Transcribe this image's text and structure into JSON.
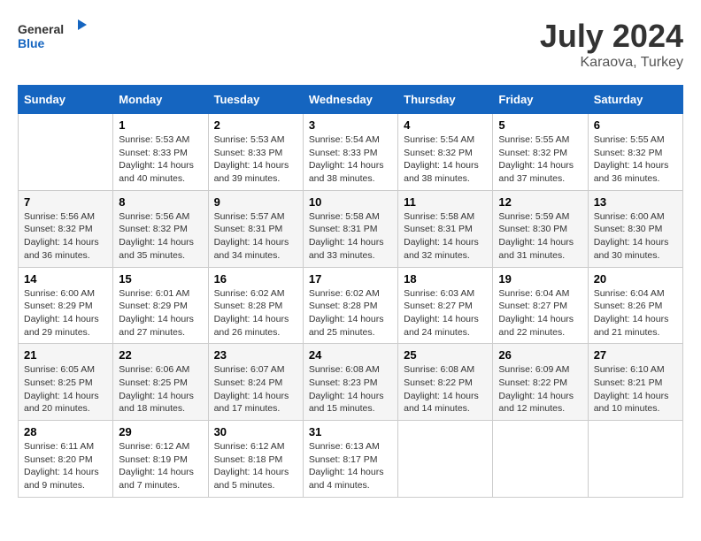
{
  "header": {
    "logo_line1": "General",
    "logo_line2": "Blue",
    "month_year": "July 2024",
    "location": "Karaova, Turkey"
  },
  "days_of_week": [
    "Sunday",
    "Monday",
    "Tuesday",
    "Wednesday",
    "Thursday",
    "Friday",
    "Saturday"
  ],
  "weeks": [
    [
      {
        "day": "",
        "info": ""
      },
      {
        "day": "1",
        "info": "Sunrise: 5:53 AM\nSunset: 8:33 PM\nDaylight: 14 hours\nand 40 minutes."
      },
      {
        "day": "2",
        "info": "Sunrise: 5:53 AM\nSunset: 8:33 PM\nDaylight: 14 hours\nand 39 minutes."
      },
      {
        "day": "3",
        "info": "Sunrise: 5:54 AM\nSunset: 8:33 PM\nDaylight: 14 hours\nand 38 minutes."
      },
      {
        "day": "4",
        "info": "Sunrise: 5:54 AM\nSunset: 8:32 PM\nDaylight: 14 hours\nand 38 minutes."
      },
      {
        "day": "5",
        "info": "Sunrise: 5:55 AM\nSunset: 8:32 PM\nDaylight: 14 hours\nand 37 minutes."
      },
      {
        "day": "6",
        "info": "Sunrise: 5:55 AM\nSunset: 8:32 PM\nDaylight: 14 hours\nand 36 minutes."
      }
    ],
    [
      {
        "day": "7",
        "info": "Sunrise: 5:56 AM\nSunset: 8:32 PM\nDaylight: 14 hours\nand 36 minutes."
      },
      {
        "day": "8",
        "info": "Sunrise: 5:56 AM\nSunset: 8:32 PM\nDaylight: 14 hours\nand 35 minutes."
      },
      {
        "day": "9",
        "info": "Sunrise: 5:57 AM\nSunset: 8:31 PM\nDaylight: 14 hours\nand 34 minutes."
      },
      {
        "day": "10",
        "info": "Sunrise: 5:58 AM\nSunset: 8:31 PM\nDaylight: 14 hours\nand 33 minutes."
      },
      {
        "day": "11",
        "info": "Sunrise: 5:58 AM\nSunset: 8:31 PM\nDaylight: 14 hours\nand 32 minutes."
      },
      {
        "day": "12",
        "info": "Sunrise: 5:59 AM\nSunset: 8:30 PM\nDaylight: 14 hours\nand 31 minutes."
      },
      {
        "day": "13",
        "info": "Sunrise: 6:00 AM\nSunset: 8:30 PM\nDaylight: 14 hours\nand 30 minutes."
      }
    ],
    [
      {
        "day": "14",
        "info": "Sunrise: 6:00 AM\nSunset: 8:29 PM\nDaylight: 14 hours\nand 29 minutes."
      },
      {
        "day": "15",
        "info": "Sunrise: 6:01 AM\nSunset: 8:29 PM\nDaylight: 14 hours\nand 27 minutes."
      },
      {
        "day": "16",
        "info": "Sunrise: 6:02 AM\nSunset: 8:28 PM\nDaylight: 14 hours\nand 26 minutes."
      },
      {
        "day": "17",
        "info": "Sunrise: 6:02 AM\nSunset: 8:28 PM\nDaylight: 14 hours\nand 25 minutes."
      },
      {
        "day": "18",
        "info": "Sunrise: 6:03 AM\nSunset: 8:27 PM\nDaylight: 14 hours\nand 24 minutes."
      },
      {
        "day": "19",
        "info": "Sunrise: 6:04 AM\nSunset: 8:27 PM\nDaylight: 14 hours\nand 22 minutes."
      },
      {
        "day": "20",
        "info": "Sunrise: 6:04 AM\nSunset: 8:26 PM\nDaylight: 14 hours\nand 21 minutes."
      }
    ],
    [
      {
        "day": "21",
        "info": "Sunrise: 6:05 AM\nSunset: 8:25 PM\nDaylight: 14 hours\nand 20 minutes."
      },
      {
        "day": "22",
        "info": "Sunrise: 6:06 AM\nSunset: 8:25 PM\nDaylight: 14 hours\nand 18 minutes."
      },
      {
        "day": "23",
        "info": "Sunrise: 6:07 AM\nSunset: 8:24 PM\nDaylight: 14 hours\nand 17 minutes."
      },
      {
        "day": "24",
        "info": "Sunrise: 6:08 AM\nSunset: 8:23 PM\nDaylight: 14 hours\nand 15 minutes."
      },
      {
        "day": "25",
        "info": "Sunrise: 6:08 AM\nSunset: 8:22 PM\nDaylight: 14 hours\nand 14 minutes."
      },
      {
        "day": "26",
        "info": "Sunrise: 6:09 AM\nSunset: 8:22 PM\nDaylight: 14 hours\nand 12 minutes."
      },
      {
        "day": "27",
        "info": "Sunrise: 6:10 AM\nSunset: 8:21 PM\nDaylight: 14 hours\nand 10 minutes."
      }
    ],
    [
      {
        "day": "28",
        "info": "Sunrise: 6:11 AM\nSunset: 8:20 PM\nDaylight: 14 hours\nand 9 minutes."
      },
      {
        "day": "29",
        "info": "Sunrise: 6:12 AM\nSunset: 8:19 PM\nDaylight: 14 hours\nand 7 minutes."
      },
      {
        "day": "30",
        "info": "Sunrise: 6:12 AM\nSunset: 8:18 PM\nDaylight: 14 hours\nand 5 minutes."
      },
      {
        "day": "31",
        "info": "Sunrise: 6:13 AM\nSunset: 8:17 PM\nDaylight: 14 hours\nand 4 minutes."
      },
      {
        "day": "",
        "info": ""
      },
      {
        "day": "",
        "info": ""
      },
      {
        "day": "",
        "info": ""
      }
    ]
  ]
}
